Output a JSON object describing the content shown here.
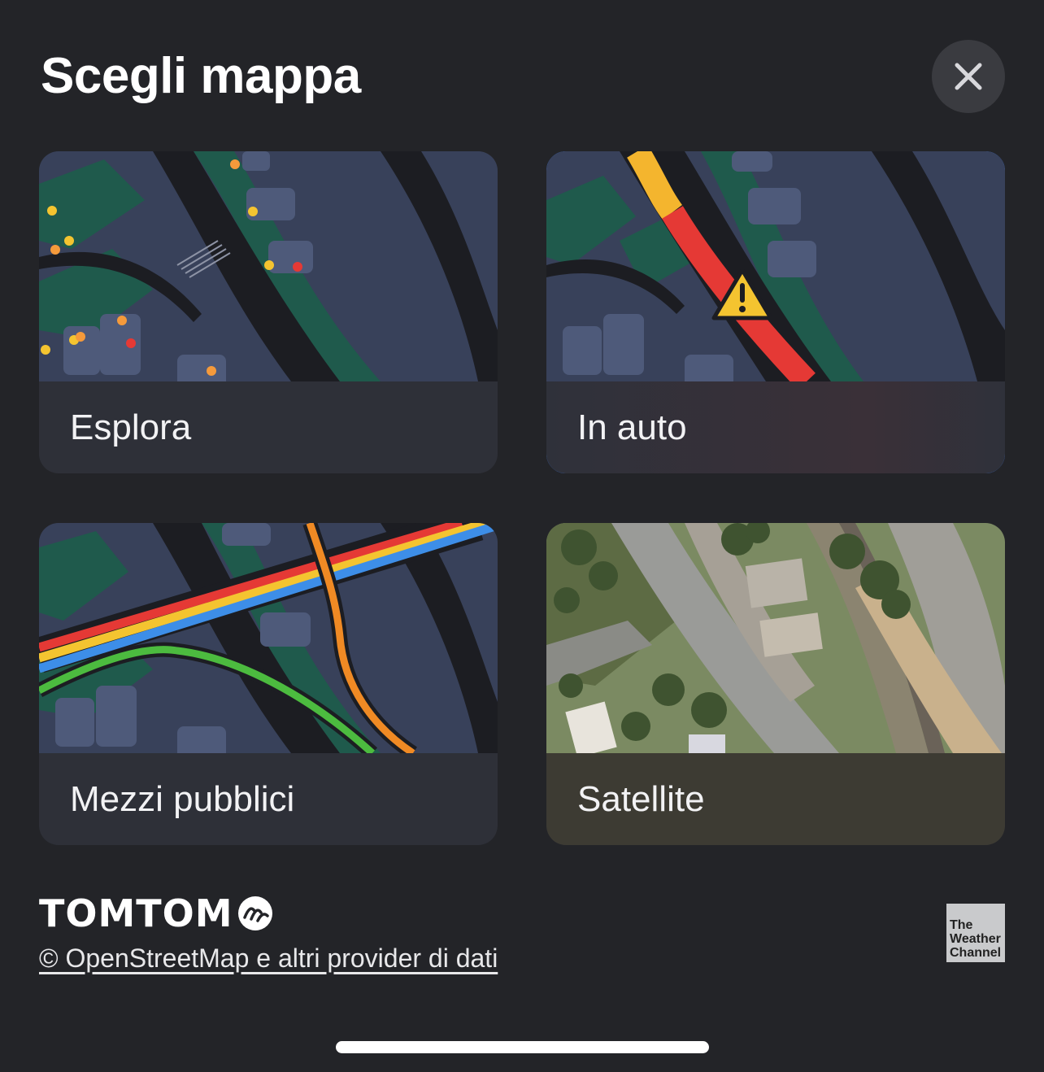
{
  "header": {
    "title": "Scegli mappa",
    "close_icon": "close-icon"
  },
  "options": [
    {
      "id": "explore",
      "label": "Esplora",
      "selected": false
    },
    {
      "id": "drive",
      "label": "In auto",
      "selected": true
    },
    {
      "id": "transit",
      "label": "Mezzi pubblici",
      "selected": false
    },
    {
      "id": "satellite",
      "label": "Satellite",
      "selected": false
    }
  ],
  "footer": {
    "brand_logo": "TOMTOM",
    "attribution": "© OpenStreetMap e altri provider di dati",
    "weather_logo": "The Weather Channel"
  },
  "colors": {
    "background": "#232428",
    "selection": "#3d7cf2",
    "map_base": "#38415a",
    "map_green": "#1f5a4c",
    "traffic_red": "#e53935",
    "traffic_yellow": "#f4b52e"
  }
}
